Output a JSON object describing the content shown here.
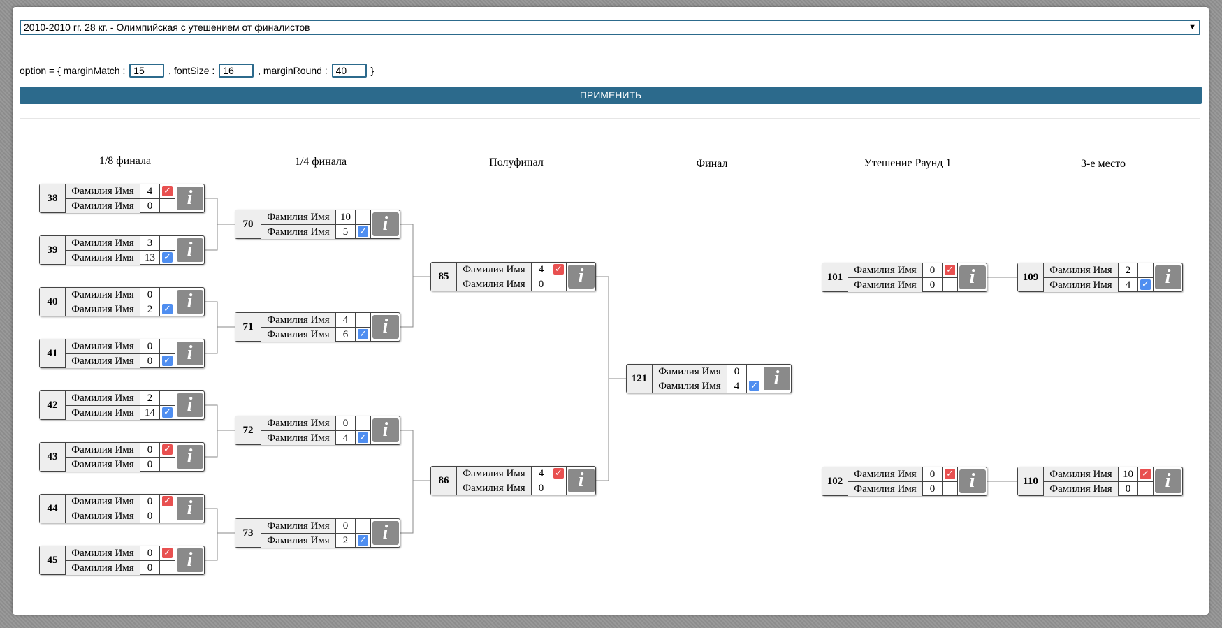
{
  "select": {
    "value": "2010-2010 гг. 28 кг. - Олимпийская с утешением от финалистов"
  },
  "options": {
    "prefix": "option = { marginMatch :",
    "sep1": ", fontSize :",
    "sep2": ", marginRound :",
    "suffix": "}",
    "marginMatch": "15",
    "fontSize": "16",
    "marginRound": "40"
  },
  "apply_label": "ПРИМЕНИТЬ",
  "info_glyph": "i",
  "rounds": [
    {
      "title": "1/8 финала"
    },
    {
      "title": "1/4 финала"
    },
    {
      "title": "Полуфинал"
    },
    {
      "title": "Финал"
    },
    {
      "title": "Утешение Раунд 1"
    },
    {
      "title": "3-е место"
    }
  ],
  "matches": [
    {
      "id": "38",
      "p1": {
        "name": "Фамилия Имя",
        "score": "4",
        "win": "red"
      },
      "p2": {
        "name": "Фамилия Имя",
        "score": "0",
        "win": ""
      }
    },
    {
      "id": "39",
      "p1": {
        "name": "Фамилия Имя",
        "score": "3",
        "win": ""
      },
      "p2": {
        "name": "Фамилия Имя",
        "score": "13",
        "win": "blue"
      }
    },
    {
      "id": "40",
      "p1": {
        "name": "Фамилия Имя",
        "score": "0",
        "win": ""
      },
      "p2": {
        "name": "Фамилия Имя",
        "score": "2",
        "win": "blue"
      }
    },
    {
      "id": "41",
      "p1": {
        "name": "Фамилия Имя",
        "score": "0",
        "win": ""
      },
      "p2": {
        "name": "Фамилия Имя",
        "score": "0",
        "win": "blue"
      }
    },
    {
      "id": "42",
      "p1": {
        "name": "Фамилия Имя",
        "score": "2",
        "win": ""
      },
      "p2": {
        "name": "Фамилия Имя",
        "score": "14",
        "win": "blue"
      }
    },
    {
      "id": "43",
      "p1": {
        "name": "Фамилия Имя",
        "score": "0",
        "win": "red"
      },
      "p2": {
        "name": "Фамилия Имя",
        "score": "0",
        "win": ""
      }
    },
    {
      "id": "44",
      "p1": {
        "name": "Фамилия Имя",
        "score": "0",
        "win": "red"
      },
      "p2": {
        "name": "Фамилия Имя",
        "score": "0",
        "win": ""
      }
    },
    {
      "id": "45",
      "p1": {
        "name": "Фамилия Имя",
        "score": "0",
        "win": "red"
      },
      "p2": {
        "name": "Фамилия Имя",
        "score": "0",
        "win": ""
      }
    },
    {
      "id": "70",
      "p1": {
        "name": "Фамилия Имя",
        "score": "10",
        "win": ""
      },
      "p2": {
        "name": "Фамилия Имя",
        "score": "5",
        "win": "blue"
      }
    },
    {
      "id": "71",
      "p1": {
        "name": "Фамилия Имя",
        "score": "4",
        "win": ""
      },
      "p2": {
        "name": "Фамилия Имя",
        "score": "6",
        "win": "blue"
      }
    },
    {
      "id": "72",
      "p1": {
        "name": "Фамилия Имя",
        "score": "0",
        "win": ""
      },
      "p2": {
        "name": "Фамилия Имя",
        "score": "4",
        "win": "blue"
      }
    },
    {
      "id": "73",
      "p1": {
        "name": "Фамилия Имя",
        "score": "0",
        "win": ""
      },
      "p2": {
        "name": "Фамилия Имя",
        "score": "2",
        "win": "blue"
      }
    },
    {
      "id": "85",
      "p1": {
        "name": "Фамилия Имя",
        "score": "4",
        "win": "red"
      },
      "p2": {
        "name": "Фамилия Имя",
        "score": "0",
        "win": ""
      }
    },
    {
      "id": "86",
      "p1": {
        "name": "Фамилия Имя",
        "score": "4",
        "win": "red"
      },
      "p2": {
        "name": "Фамилия Имя",
        "score": "0",
        "win": ""
      }
    },
    {
      "id": "121",
      "p1": {
        "name": "Фамилия Имя",
        "score": "0",
        "win": ""
      },
      "p2": {
        "name": "Фамилия Имя",
        "score": "4",
        "win": "blue"
      }
    },
    {
      "id": "101",
      "p1": {
        "name": "Фамилия Имя",
        "score": "0",
        "win": "red"
      },
      "p2": {
        "name": "Фамилия Имя",
        "score": "0",
        "win": ""
      }
    },
    {
      "id": "102",
      "p1": {
        "name": "Фамилия Имя",
        "score": "0",
        "win": "red"
      },
      "p2": {
        "name": "Фамилия Имя",
        "score": "0",
        "win": ""
      }
    },
    {
      "id": "109",
      "p1": {
        "name": "Фамилия Имя",
        "score": "2",
        "win": ""
      },
      "p2": {
        "name": "Фамилия Имя",
        "score": "4",
        "win": "blue"
      }
    },
    {
      "id": "110",
      "p1": {
        "name": "Фамилия Имя",
        "score": "10",
        "win": "red"
      },
      "p2": {
        "name": "Фамилия Имя",
        "score": "0",
        "win": ""
      }
    }
  ],
  "colors": {
    "accent": "#2c6a8c",
    "win_red": "#e85050",
    "win_blue": "#4f8ef0",
    "info_btn": "#8a8a8a"
  }
}
